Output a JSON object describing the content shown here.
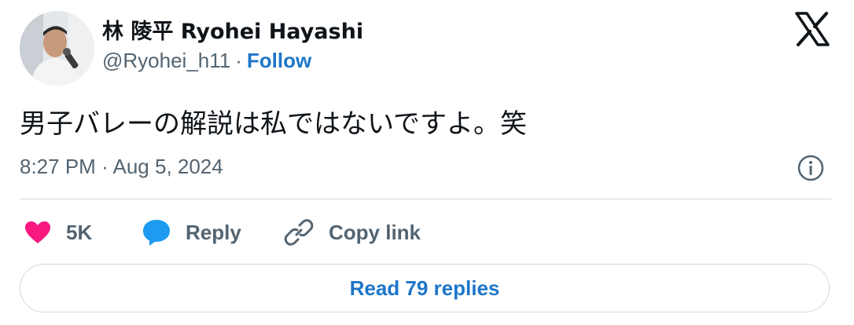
{
  "author": {
    "display_name": "林 陵平 Ryohei Hayashi",
    "handle": "@Ryohei_h11",
    "separator": "·",
    "follow_label": "Follow",
    "avatar_icon": "profile-photo"
  },
  "brand": {
    "logo_icon": "x-logo-icon"
  },
  "tweet": {
    "text": "男子バレーの解説は私ではないですよ。笑",
    "timestamp": "8:27 PM · Aug 5, 2024",
    "info_icon": "info-icon"
  },
  "actions": {
    "like_count": "5K",
    "reply_label": "Reply",
    "copy_label": "Copy link"
  },
  "footer": {
    "read_replies_label": "Read 79 replies"
  },
  "colors": {
    "accent": "#1d76c9",
    "like": "#f91880",
    "reply": "#1d9bf0",
    "muted": "#536471"
  }
}
